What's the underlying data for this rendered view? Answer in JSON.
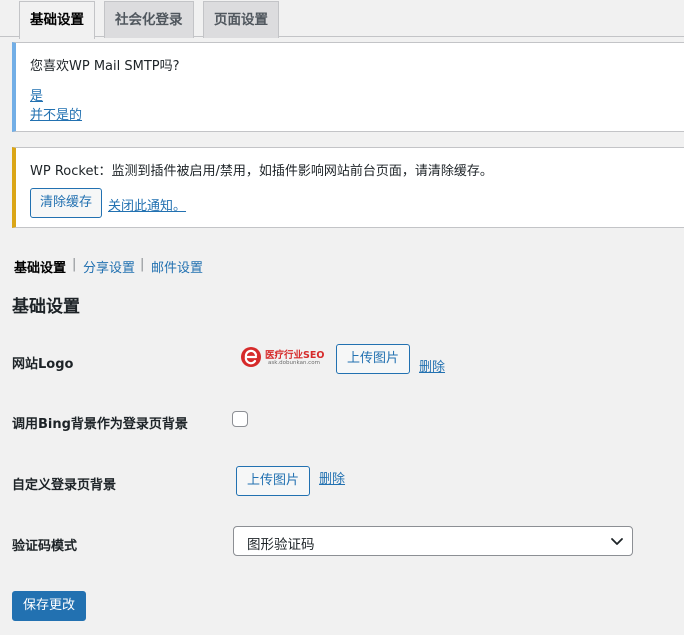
{
  "tabs": [
    {
      "label": "基础设置",
      "active": true
    },
    {
      "label": "社会化登录",
      "active": false
    },
    {
      "label": "页面设置",
      "active": false
    }
  ],
  "notice_smtp": {
    "question": "您喜欢WP Mail SMTP吗?",
    "yes_link": "是",
    "no_link": "并不是的"
  },
  "notice_rocket": {
    "message": "WP Rocket：监测到插件被启用/禁用，如插件影响网站前台页面，请清除缓存。",
    "clear_cache_button": "清除缓存",
    "dismiss_link": "关闭此通知。"
  },
  "subnav": {
    "current": "基础设置",
    "separator": "|",
    "share_link": "分享设置",
    "mail_link": "邮件设置"
  },
  "section_title": "基础设置",
  "fields": {
    "site_logo": {
      "label": "网站Logo",
      "logo_text": "医疗行业SEO",
      "logo_domain": "ask.dobunkan.com",
      "upload_button": "上传图片",
      "delete_link": "删除"
    },
    "bing_background": {
      "label": "调用Bing背景作为登录页背景",
      "checked": false
    },
    "custom_background": {
      "label": "自定义登录页背景",
      "upload_button": "上传图片",
      "delete_link": "删除"
    },
    "captcha_mode": {
      "label": "验证码模式",
      "selected": "图形验证码"
    }
  },
  "save_button": "保存更改",
  "colors": {
    "accent": "#2271b1",
    "info_border": "#72aee6",
    "warning_border": "#dba617",
    "logo_red": "#d62a2a"
  }
}
